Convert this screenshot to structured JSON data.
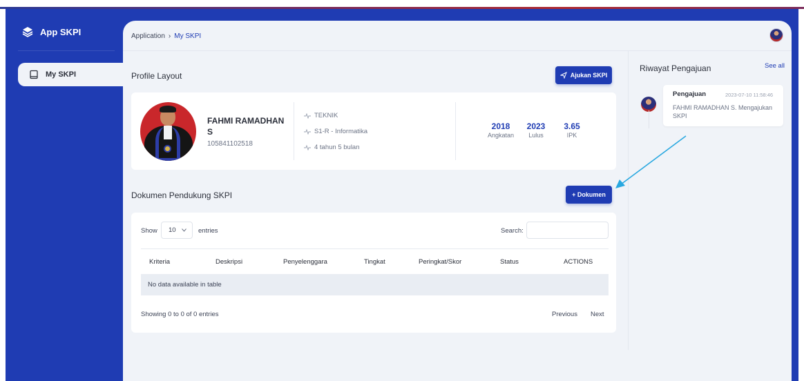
{
  "app": {
    "title": "App SKPI"
  },
  "sidebar": {
    "items": [
      {
        "label": "My SKPI",
        "icon": "book-icon"
      }
    ]
  },
  "breadcrumb": {
    "root": "Application",
    "separator": "›",
    "current": "My SKPI"
  },
  "profile": {
    "section_title": "Profile Layout",
    "submit_button": "Ajukan SKPI",
    "name": "FAHMI RAMADHAN S",
    "nim": "105841102518",
    "faculty": "TEKNIK",
    "program": "S1-R - Informatika",
    "duration": "4 tahun 5 bulan",
    "stats": [
      {
        "value": "2018",
        "label": "Angkatan"
      },
      {
        "value": "2023",
        "label": "Lulus"
      },
      {
        "value": "3.65",
        "label": "IPK"
      }
    ]
  },
  "documents": {
    "section_title": "Dokumen Pendukung SKPI",
    "add_button": "+ Dokumen",
    "show_label": "Show",
    "page_size": "10",
    "entries_label": "entries",
    "search_label": "Search:",
    "search_value": "",
    "columns": [
      "Kriteria",
      "Deskripsi",
      "Penyelenggara",
      "Tingkat",
      "Peringkat/Skor",
      "Status",
      "ACTIONS"
    ],
    "empty_text": "No data available in table",
    "info_text": "Showing 0 to 0 of 0 entries",
    "previous_label": "Previous",
    "next_label": "Next"
  },
  "history": {
    "title": "Riwayat Pengajuan",
    "see_all": "See all",
    "items": [
      {
        "title": "Pengajuan",
        "time": "2023-07-10 11:58:46",
        "description": "FAHMI RAMADHAN S. Mengajukan SKPI"
      }
    ]
  },
  "colors": {
    "primary": "#1f3cb3",
    "background": "#f0f3f8",
    "arrow": "#29a8e0"
  }
}
